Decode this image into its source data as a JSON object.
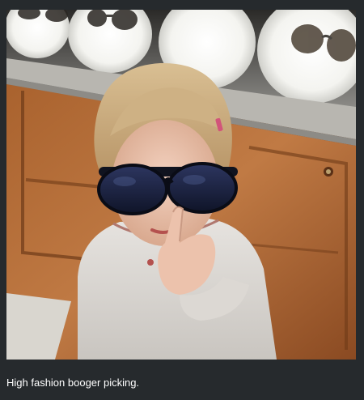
{
  "post": {
    "caption": "High fashion booger picking."
  },
  "colors": {
    "page_background": "#262a2d",
    "caption_text": "#ffffff"
  }
}
